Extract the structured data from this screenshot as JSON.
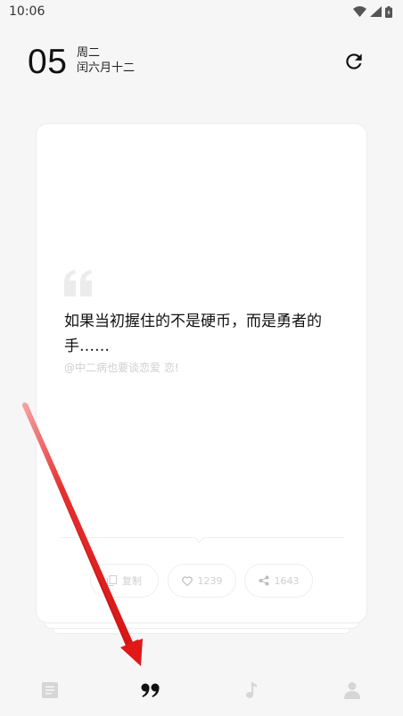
{
  "status_bar": {
    "time": "10:06",
    "icons": [
      "wifi-icon",
      "signal-icon",
      "battery-icon"
    ]
  },
  "header": {
    "day": "05",
    "weekday": "周二",
    "lunar_date": "闰六月十二",
    "refresh_icon": "refresh-icon"
  },
  "quote_card": {
    "quote_icon": "quote-icon",
    "text": "如果当初握住的不是硬币，而是勇者的手……",
    "author": "@中二病也要谈恋爱 恋!",
    "actions": {
      "copy_label": "复制",
      "like_count": "1239",
      "share_count": "1643"
    }
  },
  "bottom_nav": {
    "items": [
      {
        "name": "articles",
        "icon": "article-icon",
        "active": false
      },
      {
        "name": "quotes",
        "icon": "quote-icon",
        "active": true
      },
      {
        "name": "music",
        "icon": "music-note-icon",
        "active": false
      },
      {
        "name": "profile",
        "icon": "person-icon",
        "active": false
      }
    ]
  },
  "colors": {
    "background": "#f6f6f6",
    "card": "#ffffff",
    "arrow": "#e11a1a",
    "inactive_icon": "#d6d6d6",
    "active_icon": "#111111"
  }
}
